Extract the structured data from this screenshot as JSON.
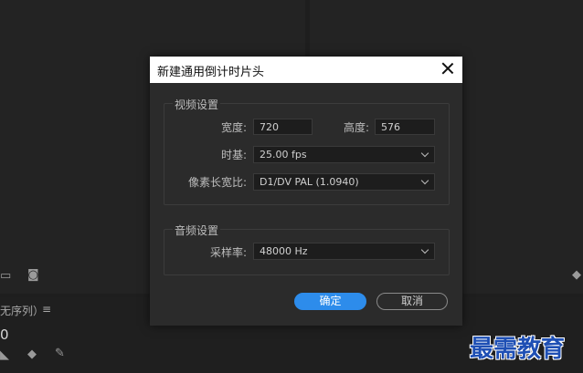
{
  "dialog": {
    "title": "新建通用倒计时片头",
    "video_group": {
      "title": "视频设置",
      "width_label": "宽度:",
      "width_value": "720",
      "height_label": "高度:",
      "height_value": "576",
      "timebase_label": "时基:",
      "timebase_value": "25.00 fps",
      "par_label": "像素长宽比:",
      "par_value": "D1/DV PAL (1.0940)"
    },
    "audio_group": {
      "title": "音频设置",
      "samplerate_label": "采样率:",
      "samplerate_value": "48000 Hz"
    },
    "ok_label": "确定",
    "cancel_label": "取消"
  },
  "background": {
    "sequence_tab_text": "无序列）",
    "menu_glyph": "≡",
    "timecode_fragment": "0"
  },
  "watermark": "最需教育",
  "colors": {
    "accent": "#2d8ceb",
    "dialog_bg": "#2b2b2b",
    "titlebar_bg": "#ffffff"
  }
}
